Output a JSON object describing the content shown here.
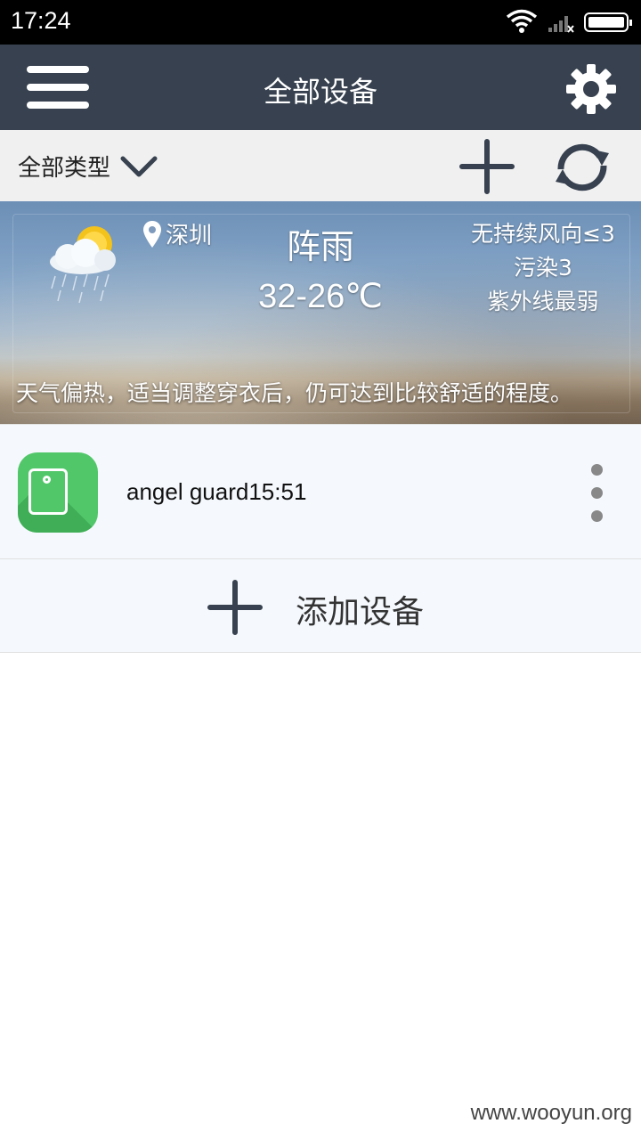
{
  "status_bar": {
    "time": "17:24"
  },
  "header": {
    "title": "全部设备",
    "menu_icon": "menu-icon",
    "settings_icon": "gear-icon"
  },
  "filter": {
    "type_label": "全部类型",
    "add_icon": "plus-icon",
    "refresh_icon": "refresh-icon"
  },
  "weather": {
    "location": "深圳",
    "condition": "阵雨",
    "temperature": "32-26℃",
    "wind": "无持续风向≤3",
    "pollution": "污染3",
    "uv": "紫外线最弱",
    "tip": "天气偏热，适当调整穿衣后，仍可达到比较舒适的程度。"
  },
  "devices": [
    {
      "name": "angel guard15:51",
      "icon": "device-icon",
      "accent": "#52c76a"
    }
  ],
  "add_device": {
    "label": "添加设备"
  },
  "watermark": "www.wooyun.org",
  "colors": {
    "header_bg": "#37414f",
    "filter_bg": "#f0f0f0",
    "device_green": "#52c76a"
  }
}
